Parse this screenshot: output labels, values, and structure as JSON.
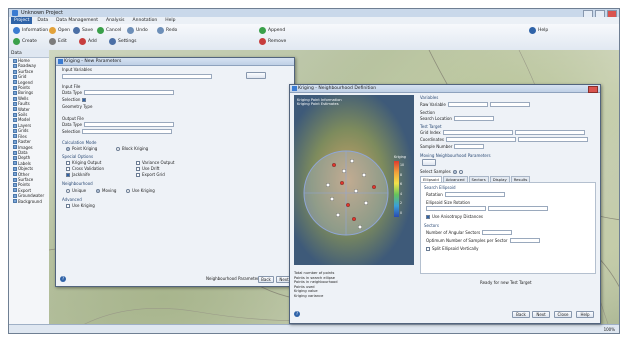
{
  "app": {
    "title": "Unknown Project",
    "ribbon_tabs": [
      "Project",
      "Data",
      "Data Management",
      "Analysis",
      "Annotation",
      "Help"
    ],
    "ribbon_buttons": [
      "Information",
      "Open",
      "Save",
      "Cancel",
      "Undo",
      "Redo",
      "Create",
      "Edit",
      "Add",
      "Settings",
      "Append",
      "Remove",
      "Help"
    ],
    "status_right": "100%"
  },
  "left_panel": {
    "header": "Data",
    "items": [
      "Home",
      "Roadway",
      "Surface",
      "Grid",
      "Legend",
      "Points",
      "Borings",
      "Wells",
      "Faults",
      "Water",
      "Soils",
      "Model",
      "Layers",
      "Grids",
      "Files",
      "Raster",
      "Images",
      "Data",
      "Depth",
      "Labels",
      "Objects",
      "Other",
      "Surface",
      "Points",
      "Export",
      "Groundwater",
      "Background"
    ]
  },
  "dialog1": {
    "title": "Kriging - New Parameters",
    "input_label": "Input Variables",
    "section_labels": [
      "Input File",
      "Data Type",
      "Selection",
      "Geometry Type",
      "Output File",
      "Data Type",
      "Selection"
    ],
    "calc_mode": "Calculation Mode",
    "calc_options": [
      "Point Kriging",
      "Block Kriging"
    ],
    "special_label": "Special Options",
    "special_options": [
      "Kriging Output",
      "Variance Output",
      "Cross Validation",
      "Use Drift",
      "Jackknife",
      "Export Grid"
    ],
    "neighbourhood": "Neighbourhood",
    "nb_options": [
      "Unique",
      "Moving",
      "Use Kriging"
    ],
    "advanced": "Advanced",
    "use_kriging": "Use Kriging",
    "footer_status": "Neighbourhood Parameters",
    "buttons": {
      "back": "Back",
      "next": "Next"
    }
  },
  "dialog2": {
    "title": "Kriging - Neighbourhood Definition",
    "map_info": [
      "Kriging Point Information",
      "Kriging Point Estimates"
    ],
    "legend": {
      "title": "Kriging",
      "values": [
        "10",
        "8",
        "6",
        "4",
        "2",
        "0"
      ]
    },
    "summary": [
      "Total number of points",
      "Points in search ellipse",
      "Points in neighbourhood",
      "Points used",
      "Kriging value",
      "Kriging variance"
    ],
    "variables_label": "Variables",
    "fields": [
      "Raw Variable",
      "Section",
      "Search Location",
      "Test Target",
      "Grid Index",
      "Coordinates",
      "Sample Number"
    ],
    "moving_label": "Moving Neighbourhood Parameters",
    "select_label": "Select Samples",
    "tabs": [
      "Ellipsoid",
      "Advanced",
      "Sectors",
      "Display",
      "Results"
    ],
    "ellipsoid": [
      "Search Ellipsoid",
      "Rotation",
      "Ellipsoid Size Rotation",
      "Use Anisotropy Distances",
      "Sectors",
      "Number of Angular Sectors",
      "Optimum Number of Samples per Sector",
      "Split Ellipsoid Vertically"
    ],
    "footer": "Ready for new Test Target",
    "buttons": {
      "back": "Back",
      "next": "Next",
      "close": "Close",
      "help": "Help"
    }
  }
}
